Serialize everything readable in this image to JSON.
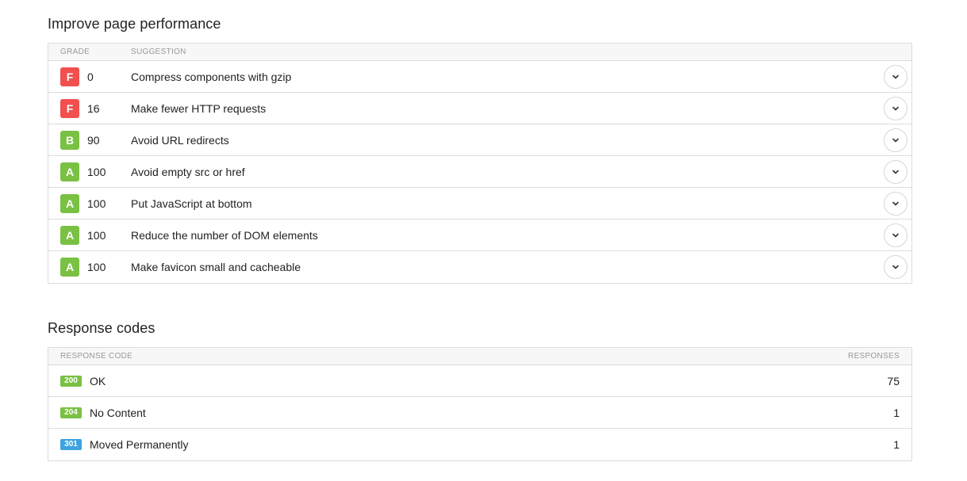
{
  "performance": {
    "title": "Improve page performance",
    "headers": {
      "grade": "GRADE",
      "suggestion": "SUGGESTION"
    },
    "rows": [
      {
        "grade": "F",
        "score": "0",
        "text": "Compress components with gzip",
        "color": "#f1504f"
      },
      {
        "grade": "F",
        "score": "16",
        "text": "Make fewer HTTP requests",
        "color": "#f1504f"
      },
      {
        "grade": "B",
        "score": "90",
        "text": "Avoid URL redirects",
        "color": "#7ac143"
      },
      {
        "grade": "A",
        "score": "100",
        "text": "Avoid empty src or href",
        "color": "#7ac143"
      },
      {
        "grade": "A",
        "score": "100",
        "text": "Put JavaScript at bottom",
        "color": "#7ac143"
      },
      {
        "grade": "A",
        "score": "100",
        "text": "Reduce the number of DOM elements",
        "color": "#7ac143"
      },
      {
        "grade": "A",
        "score": "100",
        "text": "Make favicon small and cacheable",
        "color": "#7ac143"
      }
    ]
  },
  "response_codes": {
    "title": "Response codes",
    "headers": {
      "code": "RESPONSE CODE",
      "responses": "RESPONSES"
    },
    "rows": [
      {
        "code": "200",
        "label": "OK",
        "count": "75",
        "color": "#7ac143"
      },
      {
        "code": "204",
        "label": "No Content",
        "count": "1",
        "color": "#7ac143"
      },
      {
        "code": "301",
        "label": "Moved Permanently",
        "count": "1",
        "color": "#3da3e0"
      }
    ]
  },
  "icons": {
    "expand": "chevron-down-icon"
  }
}
